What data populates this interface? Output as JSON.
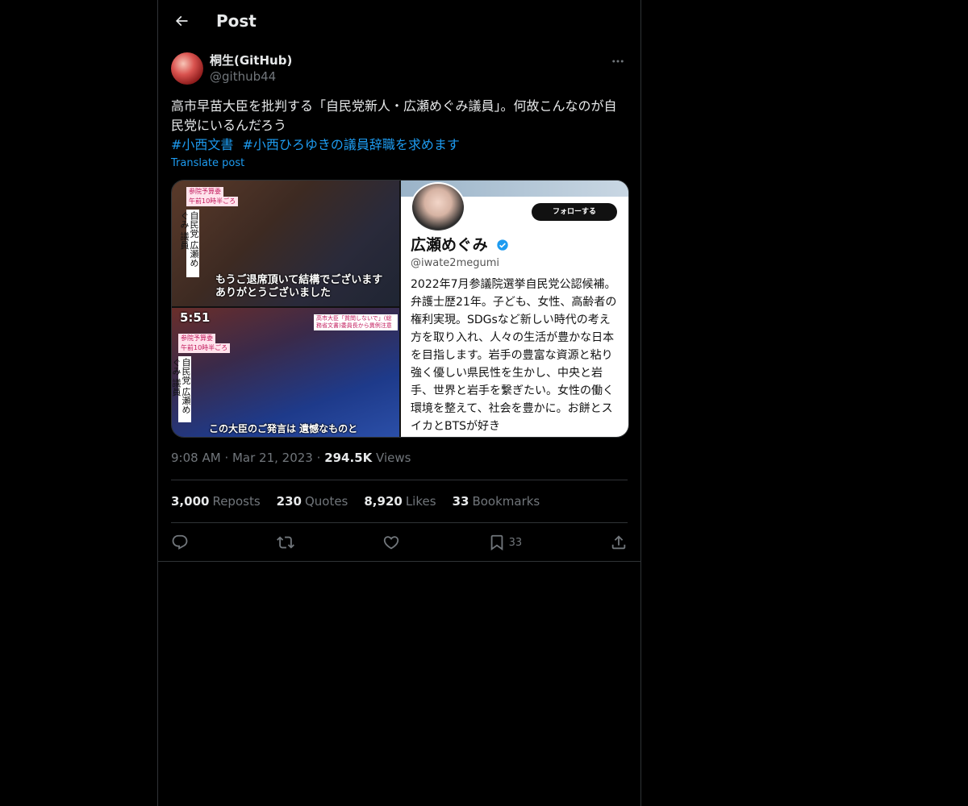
{
  "header": {
    "title": "Post"
  },
  "author": {
    "display_name": "桐生(GitHub)",
    "handle": "@github44"
  },
  "tweet": {
    "text": "高市早苗大臣を批判する「自民党新人・広瀬めぐみ議員」。何故こんなのが自民党にいるんだろう",
    "hashtags": [
      "#小西文書",
      "#小西ひろゆきの議員辞職を求めます"
    ],
    "translate_label": "Translate post"
  },
  "media": {
    "left_top": {
      "tag1": "参院予算委",
      "tag2": "午前10時半ごろ",
      "vertical": "自民党 広瀬めぐみ 議員",
      "caption": "もうご退席頂いて結構でございます ありがとうございました"
    },
    "left_bottom": {
      "time": "5:51",
      "tag1": "参院予算委",
      "tag2": "午前10時半ごろ",
      "vertical": "自民党 広瀬めぐみ 議員",
      "headline": "高市大臣「質問しないで」(総務省文書)委員長から異例注意",
      "caption": "この大臣のご発言は 遺憾なものと"
    },
    "profile_card": {
      "follow_label": "フォローする",
      "name": "広瀬めぐみ",
      "handle": "@iwate2megumi",
      "bio": "2022年7月参議院選挙自民党公認候補。弁護士歴21年。子ども、女性、高齢者の権利実現。SDGsなど新しい時代の考え方を取り入れ、人々の生活が豊かな日本を目指します。岩手の豊富な資源と粘り強く優しい県民性を生かし、中央と岩手、世界と岩手を繋ぎたい。女性の働く環境を整えて、社会を豊かに。お餅とスイカとBTSが好き"
    }
  },
  "meta": {
    "time": "9:08 AM",
    "date": "Mar 21, 2023",
    "views_count": "294.5K",
    "views_label": "Views"
  },
  "stats": {
    "reposts_count": "3,000",
    "reposts_label": "Reposts",
    "quotes_count": "230",
    "quotes_label": "Quotes",
    "likes_count": "8,920",
    "likes_label": "Likes",
    "bookmarks_count": "33",
    "bookmarks_label": "Bookmarks"
  },
  "actions": {
    "bookmark_count": "33"
  },
  "colors": {
    "background": "#000000",
    "text_primary": "#e7e9ea",
    "text_secondary": "#71767b",
    "accent": "#1d9bf0",
    "border": "#2f3336"
  }
}
